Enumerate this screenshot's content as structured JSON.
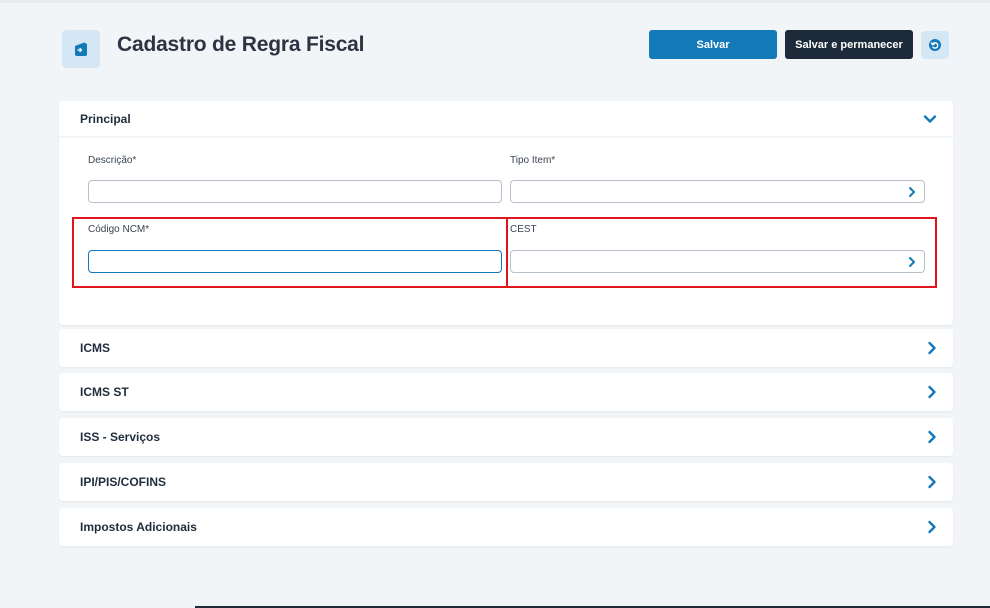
{
  "header": {
    "title": "Cadastro de Regra Fiscal",
    "save_label": "Salvar",
    "save_stay_label": "Salvar e permanecer"
  },
  "principal": {
    "title": "Principal",
    "fields": {
      "descricao_label": "Descrição*",
      "tipo_item_label": "Tipo Item*",
      "codigo_ncm_label": "Código NCM*",
      "cest_label": "CEST"
    }
  },
  "sections": [
    {
      "title": "ICMS"
    },
    {
      "title": "ICMS ST"
    },
    {
      "title": "ISS - Serviços"
    },
    {
      "title": "IPI/PIS/COFINS"
    },
    {
      "title": "Impostos Adicionais"
    }
  ],
  "colors": {
    "accent": "#1479b8",
    "dark": "#1d2a3a",
    "highlight": "#e0141a",
    "background": "#f2f5f8"
  }
}
